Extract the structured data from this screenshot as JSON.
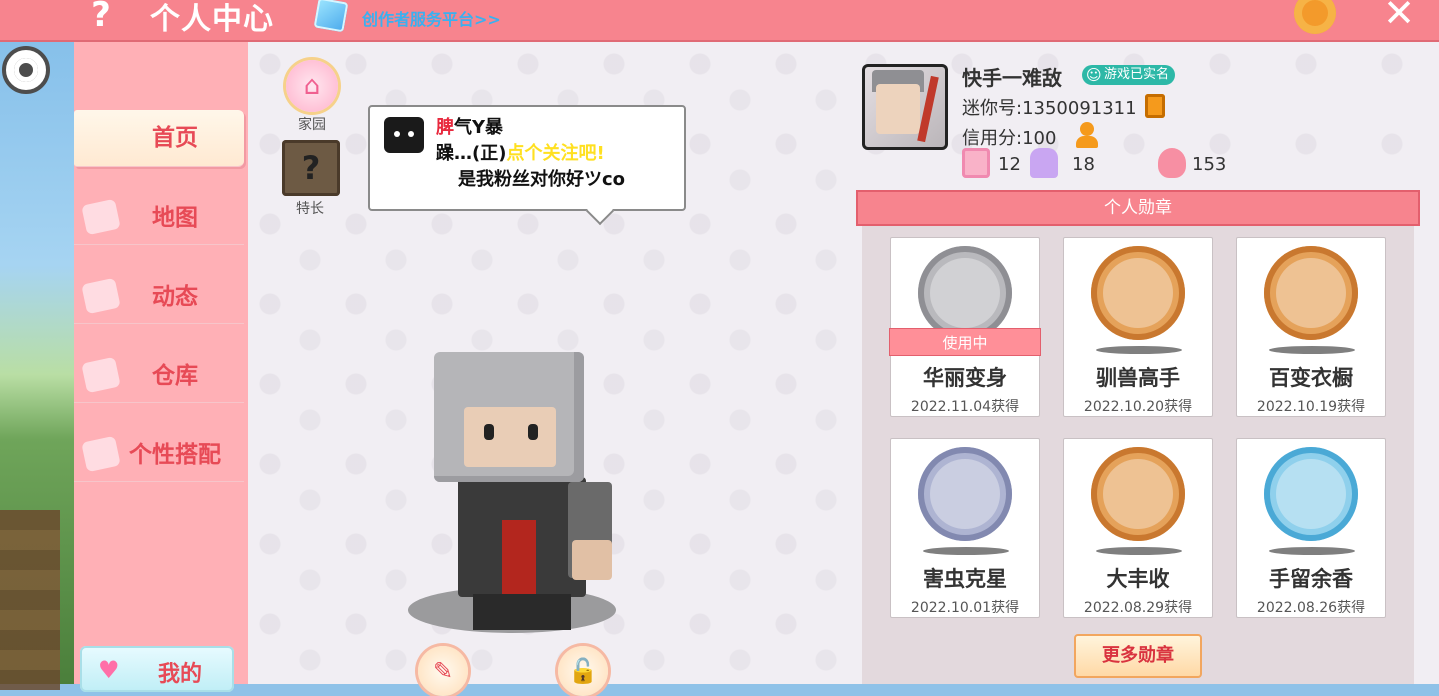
{
  "header": {
    "help_icon": "?",
    "title": "个人中心",
    "creator_link": "创作者服务平台>>",
    "close_icon": "✕"
  },
  "sidebar": {
    "items": [
      {
        "label": "首页",
        "active": true
      },
      {
        "label": "地图"
      },
      {
        "label": "动态"
      },
      {
        "label": "仓库"
      },
      {
        "label": "个性搭配"
      }
    ],
    "my_button": "我的"
  },
  "center": {
    "home_label": "家园",
    "specialty_label": "特长",
    "specialty_icon": "?",
    "bubble": {
      "part1_red": "脾",
      "part1": "气Y暴",
      "part2": "躁…(正)",
      "part2_yellow": "点个关注吧!",
      "part3": "是我粉丝对你好ツco"
    },
    "edit_icon": "✎",
    "lock_icon": "🔓"
  },
  "profile": {
    "username": "快手一难敌",
    "verified_badge": "游戏已实名",
    "mini_id": "迷你号:1350091311",
    "credit": "信用分:100",
    "stats": [
      {
        "icon": "plus-badge-icon",
        "value": "12"
      },
      {
        "icon": "trophy-icon",
        "value": "18"
      },
      {
        "icon": "flame-icon",
        "value": "153"
      }
    ]
  },
  "medals": {
    "header": "个人勋章",
    "in_use_label": "使用中",
    "items": [
      {
        "name": "华丽变身",
        "date": "2022.11.04获得",
        "color": "#b9b9bd",
        "in_use": true
      },
      {
        "name": "驯兽高手",
        "date": "2022.10.20获得",
        "color": "#e5a25a"
      },
      {
        "name": "百变衣橱",
        "date": "2022.10.19获得",
        "color": "#e5a25a"
      },
      {
        "name": "害虫克星",
        "date": "2022.10.01获得",
        "color": "#aeb4d2"
      },
      {
        "name": "大丰收",
        "date": "2022.08.29获得",
        "color": "#e5a25a"
      },
      {
        "name": "手留余香",
        "date": "2022.08.26获得",
        "color": "#8fd0ec"
      }
    ],
    "more_button": "更多勋章"
  },
  "colors": {
    "topbar": "#f7848e",
    "sidebar": "#ffb0b6",
    "accent_red": "#e74a56",
    "creator_link": "#3ab0f0",
    "verified": "#2db8a7"
  }
}
